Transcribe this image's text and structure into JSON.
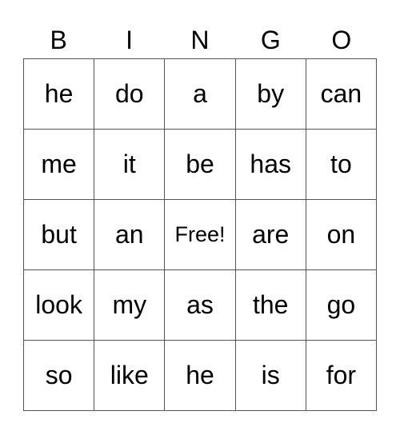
{
  "card": {
    "header": [
      "B",
      "I",
      "N",
      "G",
      "O"
    ],
    "rows": [
      [
        "he",
        "do",
        "a",
        "by",
        "can"
      ],
      [
        "me",
        "it",
        "be",
        "has",
        "to"
      ],
      [
        "but",
        "an",
        "Free!",
        "are",
        "on"
      ],
      [
        "look",
        "my",
        "as",
        "the",
        "go"
      ],
      [
        "so",
        "like",
        "he",
        "is",
        "for"
      ]
    ],
    "free_space": {
      "row": 2,
      "col": 2,
      "label": "Free!"
    }
  }
}
